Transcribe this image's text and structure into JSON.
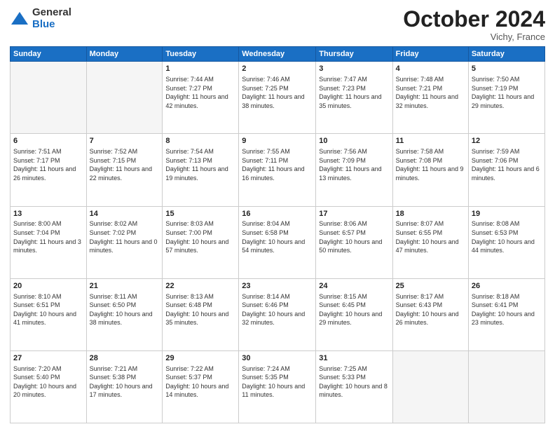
{
  "logo": {
    "general": "General",
    "blue": "Blue"
  },
  "header": {
    "month": "October 2024",
    "location": "Vichy, France"
  },
  "weekdays": [
    "Sunday",
    "Monday",
    "Tuesday",
    "Wednesday",
    "Thursday",
    "Friday",
    "Saturday"
  ],
  "weeks": [
    [
      {
        "day": "",
        "sunrise": "",
        "sunset": "",
        "daylight": "",
        "empty": true
      },
      {
        "day": "",
        "sunrise": "",
        "sunset": "",
        "daylight": "",
        "empty": true
      },
      {
        "day": "1",
        "sunrise": "Sunrise: 7:44 AM",
        "sunset": "Sunset: 7:27 PM",
        "daylight": "Daylight: 11 hours and 42 minutes.",
        "empty": false
      },
      {
        "day": "2",
        "sunrise": "Sunrise: 7:46 AM",
        "sunset": "Sunset: 7:25 PM",
        "daylight": "Daylight: 11 hours and 38 minutes.",
        "empty": false
      },
      {
        "day": "3",
        "sunrise": "Sunrise: 7:47 AM",
        "sunset": "Sunset: 7:23 PM",
        "daylight": "Daylight: 11 hours and 35 minutes.",
        "empty": false
      },
      {
        "day": "4",
        "sunrise": "Sunrise: 7:48 AM",
        "sunset": "Sunset: 7:21 PM",
        "daylight": "Daylight: 11 hours and 32 minutes.",
        "empty": false
      },
      {
        "day": "5",
        "sunrise": "Sunrise: 7:50 AM",
        "sunset": "Sunset: 7:19 PM",
        "daylight": "Daylight: 11 hours and 29 minutes.",
        "empty": false
      }
    ],
    [
      {
        "day": "6",
        "sunrise": "Sunrise: 7:51 AM",
        "sunset": "Sunset: 7:17 PM",
        "daylight": "Daylight: 11 hours and 26 minutes.",
        "empty": false
      },
      {
        "day": "7",
        "sunrise": "Sunrise: 7:52 AM",
        "sunset": "Sunset: 7:15 PM",
        "daylight": "Daylight: 11 hours and 22 minutes.",
        "empty": false
      },
      {
        "day": "8",
        "sunrise": "Sunrise: 7:54 AM",
        "sunset": "Sunset: 7:13 PM",
        "daylight": "Daylight: 11 hours and 19 minutes.",
        "empty": false
      },
      {
        "day": "9",
        "sunrise": "Sunrise: 7:55 AM",
        "sunset": "Sunset: 7:11 PM",
        "daylight": "Daylight: 11 hours and 16 minutes.",
        "empty": false
      },
      {
        "day": "10",
        "sunrise": "Sunrise: 7:56 AM",
        "sunset": "Sunset: 7:09 PM",
        "daylight": "Daylight: 11 hours and 13 minutes.",
        "empty": false
      },
      {
        "day": "11",
        "sunrise": "Sunrise: 7:58 AM",
        "sunset": "Sunset: 7:08 PM",
        "daylight": "Daylight: 11 hours and 9 minutes.",
        "empty": false
      },
      {
        "day": "12",
        "sunrise": "Sunrise: 7:59 AM",
        "sunset": "Sunset: 7:06 PM",
        "daylight": "Daylight: 11 hours and 6 minutes.",
        "empty": false
      }
    ],
    [
      {
        "day": "13",
        "sunrise": "Sunrise: 8:00 AM",
        "sunset": "Sunset: 7:04 PM",
        "daylight": "Daylight: 11 hours and 3 minutes.",
        "empty": false
      },
      {
        "day": "14",
        "sunrise": "Sunrise: 8:02 AM",
        "sunset": "Sunset: 7:02 PM",
        "daylight": "Daylight: 11 hours and 0 minutes.",
        "empty": false
      },
      {
        "day": "15",
        "sunrise": "Sunrise: 8:03 AM",
        "sunset": "Sunset: 7:00 PM",
        "daylight": "Daylight: 10 hours and 57 minutes.",
        "empty": false
      },
      {
        "day": "16",
        "sunrise": "Sunrise: 8:04 AM",
        "sunset": "Sunset: 6:58 PM",
        "daylight": "Daylight: 10 hours and 54 minutes.",
        "empty": false
      },
      {
        "day": "17",
        "sunrise": "Sunrise: 8:06 AM",
        "sunset": "Sunset: 6:57 PM",
        "daylight": "Daylight: 10 hours and 50 minutes.",
        "empty": false
      },
      {
        "day": "18",
        "sunrise": "Sunrise: 8:07 AM",
        "sunset": "Sunset: 6:55 PM",
        "daylight": "Daylight: 10 hours and 47 minutes.",
        "empty": false
      },
      {
        "day": "19",
        "sunrise": "Sunrise: 8:08 AM",
        "sunset": "Sunset: 6:53 PM",
        "daylight": "Daylight: 10 hours and 44 minutes.",
        "empty": false
      }
    ],
    [
      {
        "day": "20",
        "sunrise": "Sunrise: 8:10 AM",
        "sunset": "Sunset: 6:51 PM",
        "daylight": "Daylight: 10 hours and 41 minutes.",
        "empty": false
      },
      {
        "day": "21",
        "sunrise": "Sunrise: 8:11 AM",
        "sunset": "Sunset: 6:50 PM",
        "daylight": "Daylight: 10 hours and 38 minutes.",
        "empty": false
      },
      {
        "day": "22",
        "sunrise": "Sunrise: 8:13 AM",
        "sunset": "Sunset: 6:48 PM",
        "daylight": "Daylight: 10 hours and 35 minutes.",
        "empty": false
      },
      {
        "day": "23",
        "sunrise": "Sunrise: 8:14 AM",
        "sunset": "Sunset: 6:46 PM",
        "daylight": "Daylight: 10 hours and 32 minutes.",
        "empty": false
      },
      {
        "day": "24",
        "sunrise": "Sunrise: 8:15 AM",
        "sunset": "Sunset: 6:45 PM",
        "daylight": "Daylight: 10 hours and 29 minutes.",
        "empty": false
      },
      {
        "day": "25",
        "sunrise": "Sunrise: 8:17 AM",
        "sunset": "Sunset: 6:43 PM",
        "daylight": "Daylight: 10 hours and 26 minutes.",
        "empty": false
      },
      {
        "day": "26",
        "sunrise": "Sunrise: 8:18 AM",
        "sunset": "Sunset: 6:41 PM",
        "daylight": "Daylight: 10 hours and 23 minutes.",
        "empty": false
      }
    ],
    [
      {
        "day": "27",
        "sunrise": "Sunrise: 7:20 AM",
        "sunset": "Sunset: 5:40 PM",
        "daylight": "Daylight: 10 hours and 20 minutes.",
        "empty": false
      },
      {
        "day": "28",
        "sunrise": "Sunrise: 7:21 AM",
        "sunset": "Sunset: 5:38 PM",
        "daylight": "Daylight: 10 hours and 17 minutes.",
        "empty": false
      },
      {
        "day": "29",
        "sunrise": "Sunrise: 7:22 AM",
        "sunset": "Sunset: 5:37 PM",
        "daylight": "Daylight: 10 hours and 14 minutes.",
        "empty": false
      },
      {
        "day": "30",
        "sunrise": "Sunrise: 7:24 AM",
        "sunset": "Sunset: 5:35 PM",
        "daylight": "Daylight: 10 hours and 11 minutes.",
        "empty": false
      },
      {
        "day": "31",
        "sunrise": "Sunrise: 7:25 AM",
        "sunset": "Sunset: 5:33 PM",
        "daylight": "Daylight: 10 hours and 8 minutes.",
        "empty": false
      },
      {
        "day": "",
        "sunrise": "",
        "sunset": "",
        "daylight": "",
        "empty": true
      },
      {
        "day": "",
        "sunrise": "",
        "sunset": "",
        "daylight": "",
        "empty": true
      }
    ]
  ]
}
